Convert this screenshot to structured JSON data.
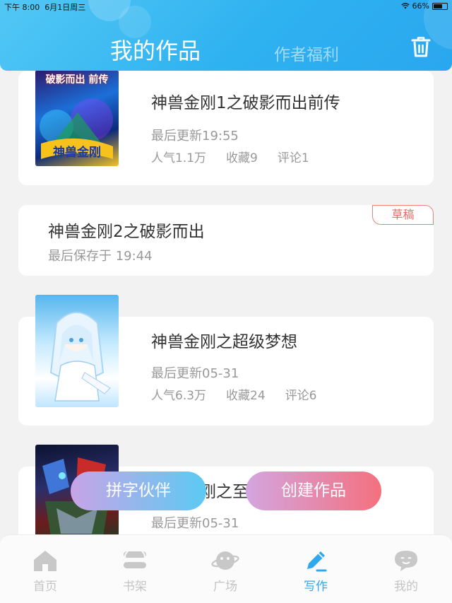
{
  "status_bar": {
    "time": "下午 8:00",
    "date": "6月1日周三",
    "battery": "66%",
    "battery_level": 0.66
  },
  "header": {
    "tab_active": "我的作品",
    "tab_inactive": "作者福利",
    "trash_icon": "trash-icon"
  },
  "works": [
    {
      "title": "神兽金刚1之破影而出前传",
      "updated": "最后更新19:55",
      "popularity": "人气1.1万",
      "favorites": "收藏9",
      "comments": "评论1",
      "cover_text": "破影而出 前传"
    },
    {
      "title": "神兽金刚2之破影而出",
      "saved": "最后保存于 19:44",
      "badge": "草稿"
    },
    {
      "title": "神兽金刚之超级梦想",
      "updated": "最后更新05-31",
      "popularity": "人气6.3万",
      "favorites": "收藏24",
      "comments": "评论6"
    },
    {
      "title": "神兽金刚之至",
      "updated": "最后更新05-31"
    }
  ],
  "floating": {
    "partner": "拼字伙伴",
    "create": "创建作品"
  },
  "nav": [
    {
      "label": "首页",
      "icon": "home-icon"
    },
    {
      "label": "书架",
      "icon": "bookshelf-icon"
    },
    {
      "label": "广场",
      "icon": "planet-icon"
    },
    {
      "label": "写作",
      "icon": "pen-icon",
      "active": true
    },
    {
      "label": "我的",
      "icon": "chat-face-icon"
    }
  ],
  "colors": {
    "header_blue": "#2fb2f0",
    "accent": "#2ea8ef",
    "draft_red": "#e96a6a",
    "pill_pink": "#f4707f"
  }
}
